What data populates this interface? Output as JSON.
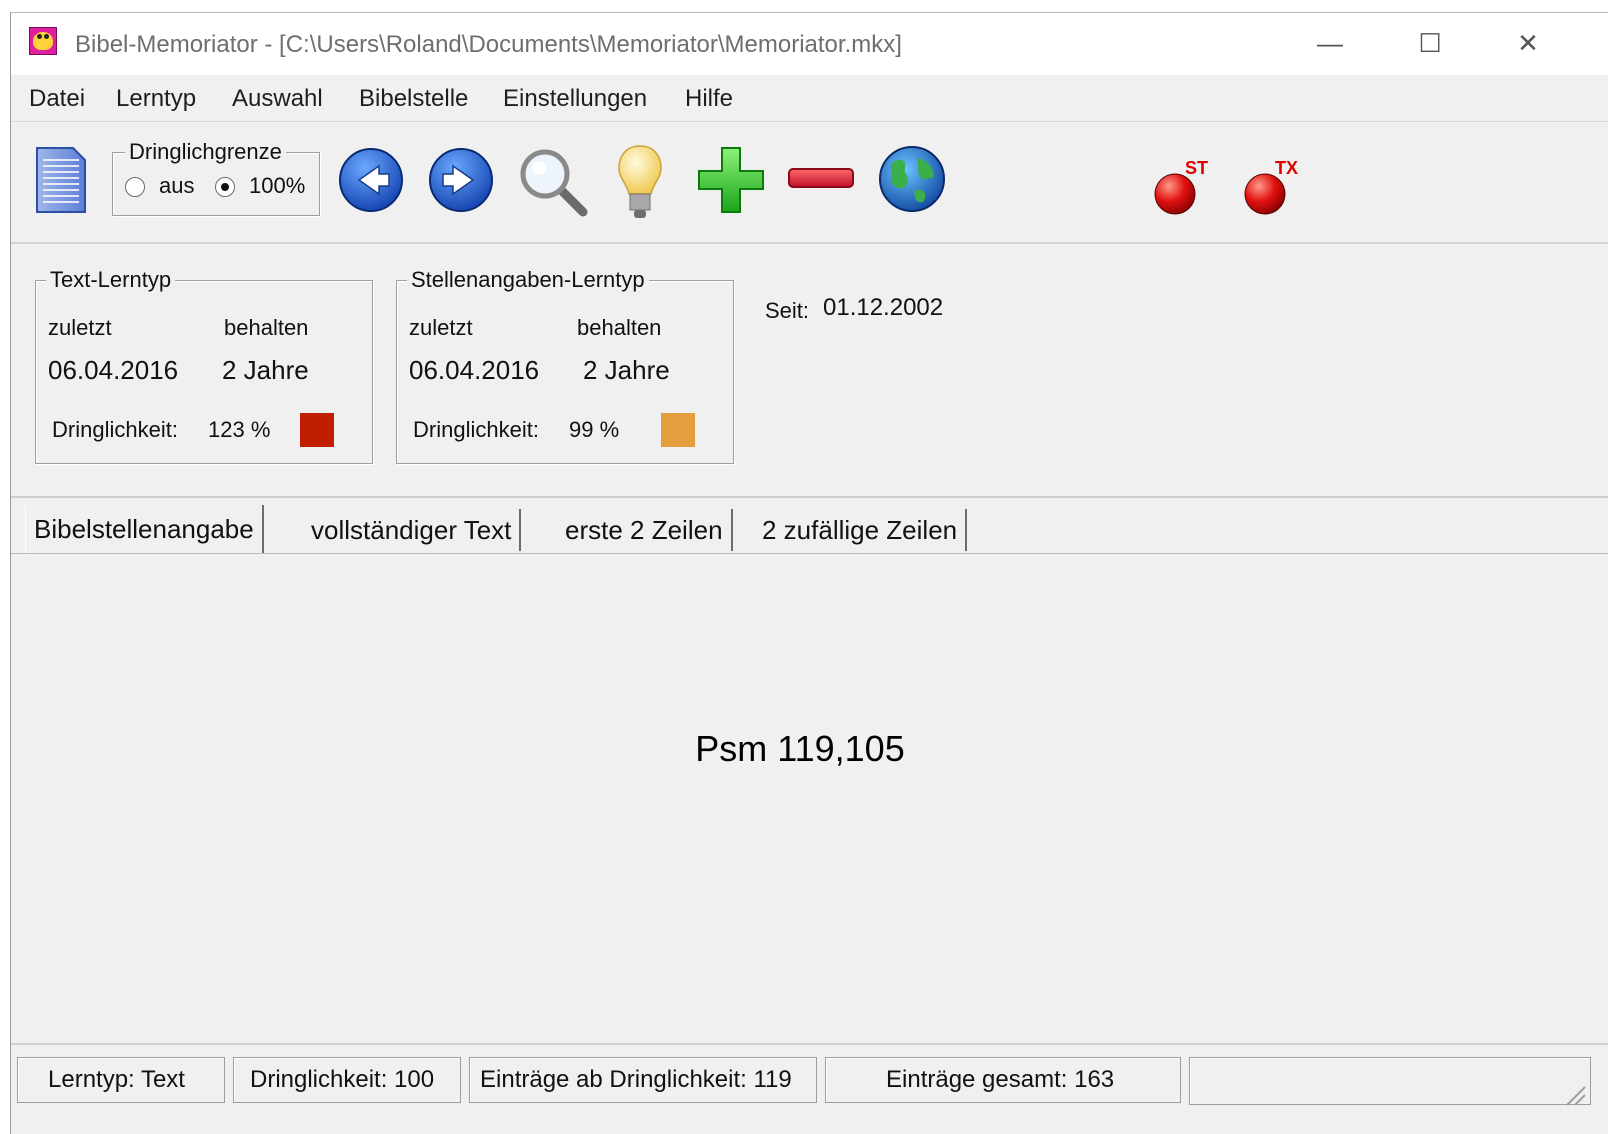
{
  "window": {
    "title": "Bibel-Memoriator - [C:\\Users\\Roland\\Documents\\Memoriator\\Memoriator.mkx]",
    "minimize_glyph": "—",
    "maximize_glyph": "☐",
    "close_glyph": "✕"
  },
  "menu": {
    "items": [
      "Datei",
      "Lerntyp",
      "Auswahl",
      "Bibelstelle",
      "Einstellungen",
      "Hilfe"
    ]
  },
  "toolbar": {
    "document_icon": "document-icon",
    "dringlichgrenze": {
      "legend": "Dringlichgrenze",
      "option_off": "aus",
      "option_on": "100%",
      "selected": "100%"
    },
    "buttons": [
      "back-arrow-icon",
      "forward-arrow-icon",
      "search-icon",
      "lightbulb-icon",
      "plus-icon",
      "minus-icon",
      "globe-icon"
    ],
    "record_st_label": "ST",
    "record_tx_label": "TX"
  },
  "text_lerntyp": {
    "legend": "Text-Lerntyp",
    "zuletzt_label": "zuletzt",
    "behalten_label": "behalten",
    "zuletzt_value": "06.04.2016",
    "behalten_value": "2 Jahre",
    "dringlichkeit_label": "Dringlichkeit:",
    "dringlichkeit_value": "123 %",
    "swatch_color": "#c01e00"
  },
  "stellen_lerntyp": {
    "legend": "Stellenangaben-Lerntyp",
    "zuletzt_label": "zuletzt",
    "behalten_label": "behalten",
    "zuletzt_value": "06.04.2016",
    "behalten_value": "2 Jahre",
    "dringlichkeit_label": "Dringlichkeit:",
    "dringlichkeit_value": "99 %",
    "swatch_color": "#e39e3e"
  },
  "seit": {
    "label": "Seit:",
    "value": "01.12.2002"
  },
  "tabs": [
    "Bibelstellenangabe",
    "vollständiger Text",
    "erste 2 Zeilen",
    "2 zufällige Zeilen"
  ],
  "active_tab": "Bibelstellenangabe",
  "content": {
    "reference": "Psm 119,105"
  },
  "status": {
    "lerntyp": "Lerntyp: Text",
    "dringlichkeit": "Dringlichkeit: 100",
    "eintraege_ab": "Einträge ab Dringlichkeit: 119",
    "eintraege_gesamt": "Einträge gesamt: 163"
  }
}
